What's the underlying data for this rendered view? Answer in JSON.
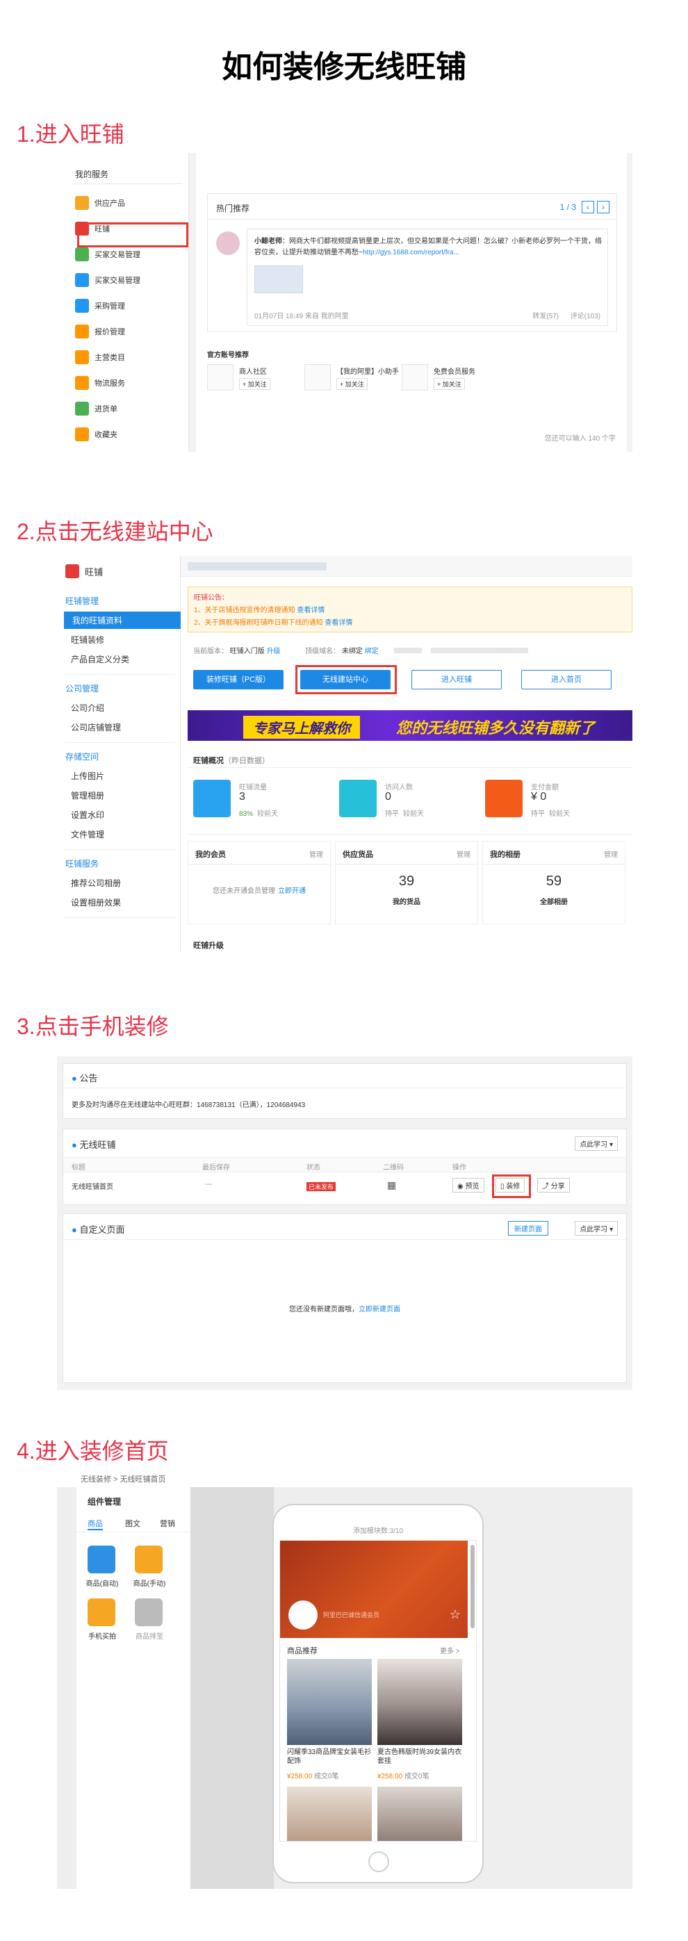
{
  "title": "如何装修无线旺铺",
  "steps": [
    "1.进入旺铺",
    "2.点击无线建站中心",
    "3.点击手机装修",
    "4.进入装修首页"
  ],
  "s1": {
    "sidebar_header": "我的服务",
    "items": [
      {
        "label": "供应产品",
        "icon": "supply-icon",
        "color": "#f5a623"
      },
      {
        "label": "旺铺",
        "icon": "shop-icon",
        "color": "#e53935"
      },
      {
        "label": "买家交易管理",
        "icon": "buyer-trade-icon",
        "color": "#4caf50"
      },
      {
        "label": "买家交易管理",
        "icon": "buyer-trade-icon-2",
        "color": "#2196f3"
      },
      {
        "label": "采购管理",
        "icon": "purchase-icon",
        "color": "#2196f3"
      },
      {
        "label": "报价管理",
        "icon": "quote-icon",
        "color": "#ff9800"
      },
      {
        "label": "主营类目",
        "icon": "category-icon",
        "color": "#ff9800"
      },
      {
        "label": "物流服务",
        "icon": "logistics-icon",
        "color": "#ff9800"
      },
      {
        "label": "进货单",
        "icon": "order-icon",
        "color": "#4caf50"
      },
      {
        "label": "收藏夹",
        "icon": "favorite-icon",
        "color": "#ff9800"
      }
    ],
    "hot_title": "热门推荐",
    "page_indicator": "1 / 3",
    "post_author": "小鲸老师",
    "post_text": "：网商大牛们都视频提高销量更上层次，但交易如果是个大问题！怎么破？小新老师必罗列一个干货，络容位卖，让提升助推动销量不再愁~",
    "post_link": "http://gys.1688.com/report/fra...",
    "post_date": "01月07日 16:49",
    "post_source": "来自 我的阿里",
    "post_share": "转发(57)",
    "post_comment": "评论(103)",
    "official_title": "官方账号推荐",
    "accounts": [
      {
        "name": "商人社区",
        "follow": "+ 加关注"
      },
      {
        "name": "【我的阿里】小助手",
        "follow": "+ 加关注"
      },
      {
        "name": "免费会员服务",
        "follow": "+ 加关注"
      }
    ],
    "footer": "您还可以输入 140 个字"
  },
  "s2": {
    "brand": "旺铺",
    "groups": [
      {
        "head": "旺铺管理",
        "items": [
          "我的旺铺资料",
          "旺铺装修",
          "产品自定义分类"
        ]
      },
      {
        "head": "公司管理",
        "items": [
          "公司介绍",
          "公司店铺管理"
        ]
      },
      {
        "head": "存储空间",
        "items": [
          "上传图片",
          "管理相册",
          "设置水印",
          "文件管理"
        ]
      },
      {
        "head": "旺铺服务",
        "items": [
          "推荐公司相册",
          "设置相册效果"
        ]
      }
    ],
    "notice_title": "旺铺公告：",
    "notice_1": "1、关于店铺违规宣传的清理通知",
    "notice_1_link": "查看详情",
    "notice_2": "2、关于旗舰海报刷旺铺昨日期下线的通知",
    "notice_2_link": "查看详情",
    "version_label": "当前版本：",
    "version_value": "旺铺入门版",
    "upgrade": "升级",
    "domain_label": "顶级域名：",
    "domain_value": "未绑定",
    "bind": "绑定",
    "buttons": [
      "装修旺铺（PC版）",
      "无线建站中心",
      "进入旺铺",
      "进入首页"
    ],
    "banner_left": "专家马上解救你",
    "banner_right": "您的无线旺铺多久没有翻新了",
    "overview_title": "旺铺概况",
    "overview_sub": "（昨日数据）",
    "stats": [
      {
        "label": "旺铺流量",
        "value": "3",
        "trend": "83%",
        "trend_label": "较前天",
        "color": "#29a3f0"
      },
      {
        "label": "访问人数",
        "value": "0",
        "trend": "持平",
        "trend_label": "较前天",
        "color": "#28c0d8"
      },
      {
        "label": "支付金额",
        "value": "¥ 0",
        "trend": "持平",
        "trend_label": "较前天",
        "color": "#f25b1a"
      }
    ],
    "cards": [
      {
        "title": "我的会员",
        "manage": "管理",
        "body": "您还未开通会员管理",
        "link": "立即开通"
      },
      {
        "title": "供应货品",
        "manage": "管理",
        "num": "39",
        "sub": "我的货品"
      },
      {
        "title": "我的相册",
        "manage": "管理",
        "num": "59",
        "sub": "全部相册"
      }
    ],
    "upgrade_title": "旺铺升级"
  },
  "s3": {
    "notice_title": "公告",
    "notice_text": "更多及时沟通尽在无线建站中心旺旺群：1468738131（已满），1204684943",
    "wireless_title": "无线旺铺",
    "learn": "点此学习",
    "columns": [
      "标题",
      "最后保存",
      "状态",
      "二维码",
      "操作"
    ],
    "row_title": "无线旺铺首页",
    "row_saved": "---",
    "row_status": "已未发布",
    "preview": "预览",
    "decorate": "装修",
    "share": "分享",
    "custom_title": "自定义页面",
    "new_page": "新建页面",
    "learn2": "点此学习",
    "empty_text": "您还没有新建页面哦，",
    "empty_link": "立即新建页面"
  },
  "s4": {
    "breadcrumb": "无线装修 > 无线旺铺首页",
    "panel_title": "组件管理",
    "tabs": [
      "商品",
      "图文",
      "营销"
    ],
    "components": [
      {
        "label": "商品(自动)",
        "color": "#2f8fe3"
      },
      {
        "label": "商品(手动)",
        "color": "#f5a623"
      },
      {
        "label": "手机买拍",
        "color": "#f5a623"
      },
      {
        "label": "商品排至",
        "color": "#bbbbbb"
      }
    ],
    "phone_status": "添加模块数:3/10",
    "banner_brand": "阿里巴巴诚信通会员",
    "recommend_title": "商品推荐",
    "more": "更多 >",
    "products": [
      {
        "name": "闪耀季33商品牌宝女装毛衫配饰",
        "price": "¥258.00",
        "sold": "成交0笔"
      },
      {
        "name": "夏古色韩版时尚39女装内衣套挂",
        "price": "¥258.00",
        "sold": "成交0笔"
      }
    ]
  }
}
